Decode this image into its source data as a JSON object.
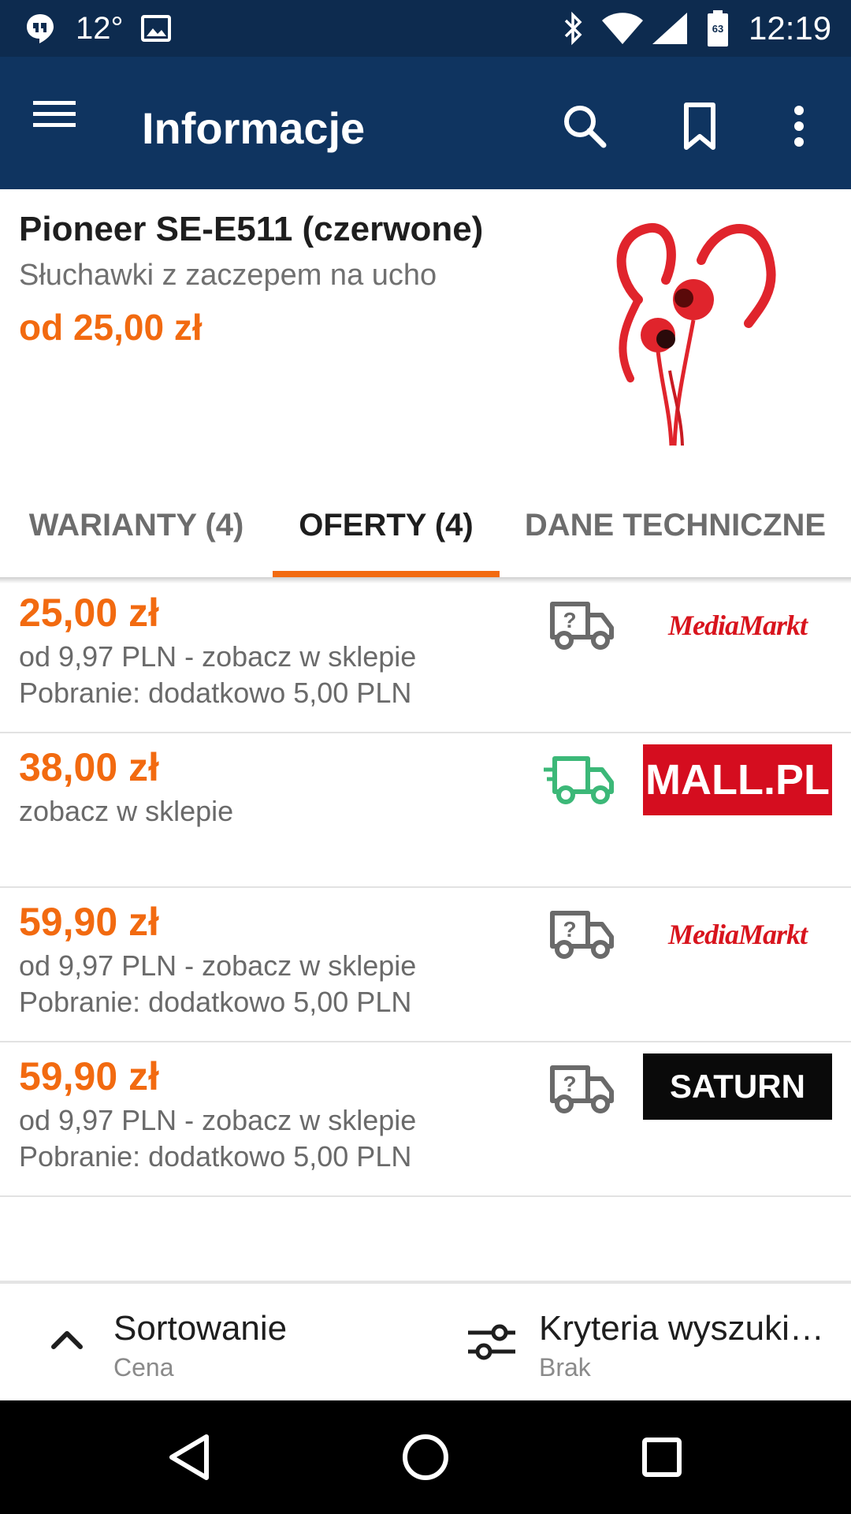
{
  "status_bar": {
    "temperature": "12°",
    "time": "12:19",
    "battery_level": "63",
    "icons": [
      "hangouts-icon",
      "image-icon",
      "bluetooth-icon",
      "wifi-icon",
      "signal-icon",
      "battery-icon"
    ]
  },
  "app_bar": {
    "title": "Informacje",
    "icons": [
      "menu-icon",
      "search-icon",
      "bookmark-icon",
      "more-vert-icon"
    ],
    "color": "#0f3460"
  },
  "product": {
    "name": "Pioneer SE-E511 (czerwone)",
    "subtitle": "Słuchawki z zaczepem na ucho",
    "price_from": "od 25,00 zł",
    "image": "red-earphones-image"
  },
  "tabs": [
    {
      "label": "WARIANTY (4)",
      "active": false
    },
    {
      "label": "OFERTY (4)",
      "active": true
    },
    {
      "label": "DANE TECHNICZNE",
      "active": false
    }
  ],
  "offers": [
    {
      "price": "25,00 zł",
      "line1": "od 9,97 PLN - zobacz w sklepie",
      "line2": "Pobranie: dodatkowo 5,00 PLN",
      "delivery_icon": "truck-unknown-icon",
      "shop": "MediaMarkt"
    },
    {
      "price": "38,00 zł",
      "line1": "zobacz w sklepie",
      "line2": "",
      "delivery_icon": "truck-fast-icon",
      "shop": "MALL.PL"
    },
    {
      "price": "59,90 zł",
      "line1": "od 9,97 PLN - zobacz w sklepie",
      "line2": "Pobranie: dodatkowo 5,00 PLN",
      "delivery_icon": "truck-unknown-icon",
      "shop": "MediaMarkt"
    },
    {
      "price": "59,90 zł",
      "line1": "od 9,97 PLN - zobacz w sklepie",
      "line2": "Pobranie: dodatkowo 5,00 PLN",
      "delivery_icon": "truck-unknown-icon",
      "shop": "SATURN"
    }
  ],
  "bottom_bar": {
    "sort_label": "Sortowanie",
    "sort_value": "Cena",
    "criteria_label": "Kryteria wyszuki…",
    "criteria_value": "Brak"
  },
  "colors": {
    "accent": "#f26a10",
    "truck_available": "#3cb878",
    "truck_unknown": "#6a6a6a"
  }
}
